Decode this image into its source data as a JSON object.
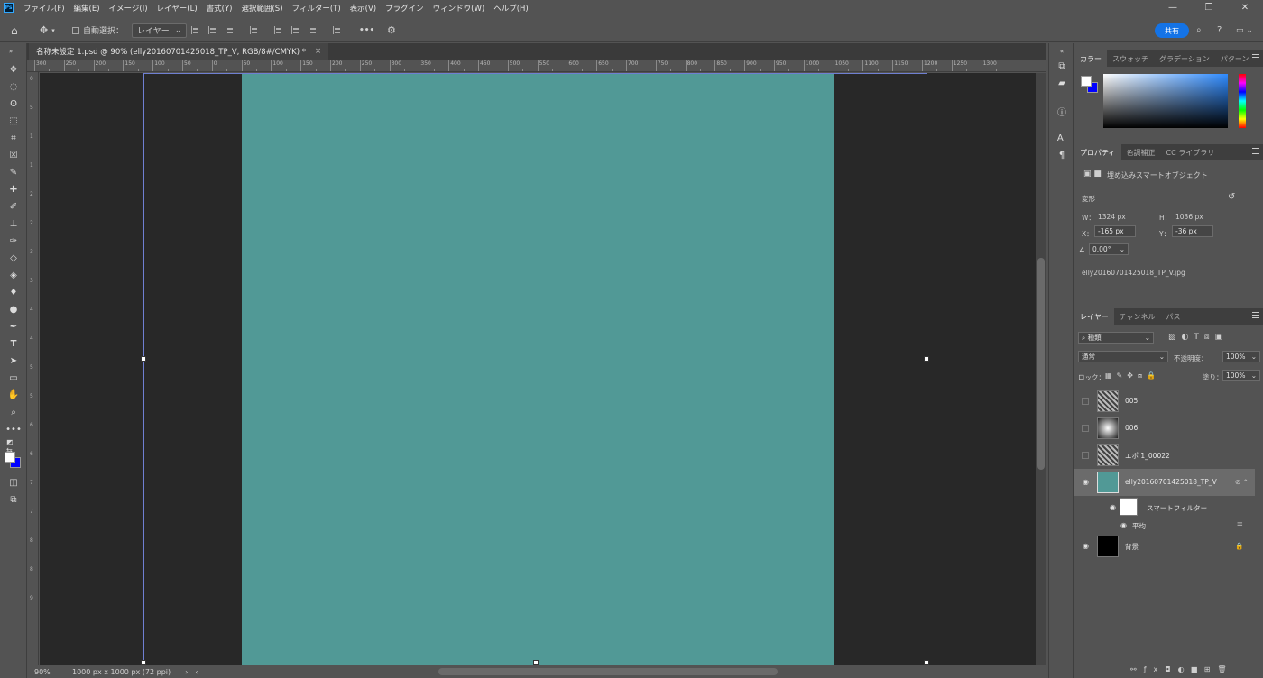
{
  "menu": [
    "ファイル(F)",
    "編集(E)",
    "イメージ(I)",
    "レイヤー(L)",
    "書式(Y)",
    "選択範囲(S)",
    "フィルター(T)",
    "表示(V)",
    "プラグイン",
    "ウィンドウ(W)",
    "ヘルプ(H)"
  ],
  "app_logo": "Ps",
  "options": {
    "auto_select_label": "自動選択：",
    "target": "レイヤー",
    "more": "•••",
    "share": "共有"
  },
  "document": {
    "tab_title": "名称未設定 1.psd @ 90% (elly20160701425018_TP_V, RGB/8#/CMYK) *",
    "canvas_color": "#519996",
    "zoom": "90%",
    "doc_info": "1000 px x 1000 px (72 ppi)"
  },
  "ruler": {
    "top": [
      "300",
      "250",
      "200",
      "150",
      "100",
      "50",
      "0",
      "50",
      "100",
      "150",
      "200",
      "250",
      "300",
      "350",
      "400",
      "450",
      "500",
      "550",
      "600",
      "650",
      "700",
      "750",
      "800",
      "850",
      "900",
      "950",
      "1000",
      "1050",
      "1100",
      "1150",
      "1200",
      "1250",
      "1300"
    ],
    "left": [
      "0",
      "5",
      "1",
      "1",
      "2",
      "2",
      "3",
      "3",
      "4",
      "4",
      "5",
      "5",
      "6",
      "6",
      "7",
      "7",
      "8",
      "8",
      "9"
    ]
  },
  "color_panel": {
    "tabs": [
      "カラー",
      "スウォッチ",
      "グラデーション",
      "パターン"
    ],
    "fg": "#ffffff",
    "bg": "#0000ff"
  },
  "properties": {
    "tabs": [
      "プロパティ",
      "色調補正",
      "CC ライブラリ"
    ],
    "object_type": "埋め込みスマートオブジェクト",
    "section": "変形",
    "w_label": "W：",
    "w": "1324 px",
    "h_label": "H：",
    "h": "1036 px",
    "x_label": "X：",
    "x": "-165 px",
    "y_label": "Y：",
    "y": "-36 px",
    "angle": "0.00°",
    "file": "elly20160701425018_TP_V.jpg"
  },
  "layers_panel": {
    "tabs": [
      "レイヤー",
      "チャンネル",
      "パス"
    ],
    "filter": "種類",
    "blend": "通常",
    "opacity_label": "不透明度：",
    "opacity": "100%",
    "lock_label": "ロック：",
    "fill_label": "塗り：",
    "fill": "100%",
    "layers": [
      {
        "name": "005",
        "visible": false
      },
      {
        "name": "006",
        "visible": false
      },
      {
        "name": "エポ 1_00022",
        "visible": false
      },
      {
        "name": "elly20160701425018_TP_V",
        "visible": true,
        "selected": true
      },
      {
        "name": "スマートフィルター"
      },
      {
        "name": "平均"
      },
      {
        "name": "背景",
        "visible": true
      }
    ]
  }
}
